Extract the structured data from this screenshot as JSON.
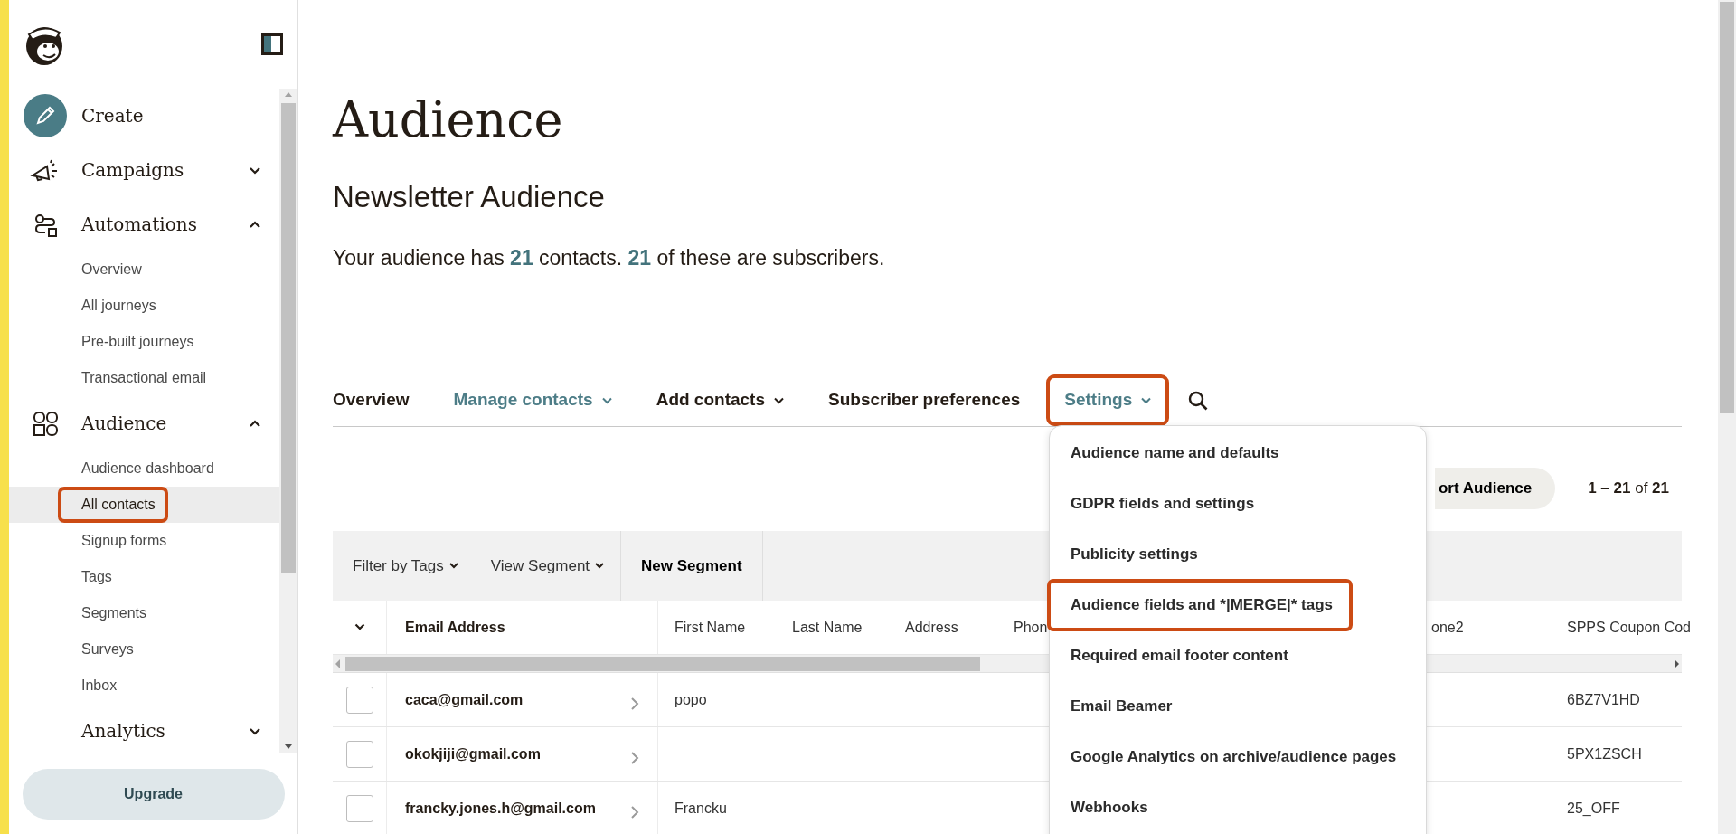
{
  "sidebar": {
    "nav": [
      {
        "kind": "action",
        "label": "Create"
      },
      {
        "kind": "section",
        "label": "Campaigns",
        "expanded": false
      },
      {
        "kind": "section",
        "label": "Automations",
        "expanded": true,
        "children": [
          {
            "label": "Overview",
            "selected": false,
            "highlighted": false
          },
          {
            "label": "All journeys",
            "selected": false,
            "highlighted": false
          },
          {
            "label": "Pre-built journeys",
            "selected": false,
            "highlighted": false
          },
          {
            "label": "Transactional email",
            "selected": false,
            "highlighted": false
          }
        ]
      },
      {
        "kind": "section",
        "label": "Audience",
        "expanded": true,
        "children": [
          {
            "label": "Audience dashboard",
            "selected": false,
            "highlighted": false
          },
          {
            "label": "All contacts",
            "selected": true,
            "highlighted": true
          },
          {
            "label": "Signup forms",
            "selected": false,
            "highlighted": false
          },
          {
            "label": "Tags",
            "selected": false,
            "highlighted": false
          },
          {
            "label": "Segments",
            "selected": false,
            "highlighted": false
          },
          {
            "label": "Surveys",
            "selected": false,
            "highlighted": false
          },
          {
            "label": "Inbox",
            "selected": false,
            "highlighted": false
          }
        ]
      },
      {
        "kind": "section",
        "label": "Analytics",
        "expanded": false
      }
    ],
    "upgrade_button": "Upgrade"
  },
  "page": {
    "title": "Audience",
    "subtitle": "Newsletter Audience",
    "summary": "Your audience has **21** contacts. **21** of these are subscribers."
  },
  "tabs": [
    {
      "label": "Overview",
      "selected": false,
      "has_menu": false,
      "highlighted": false
    },
    {
      "label": "Manage contacts",
      "selected": true,
      "has_menu": true,
      "highlighted": false
    },
    {
      "label": "Add contacts",
      "selected": false,
      "has_menu": true,
      "highlighted": false
    },
    {
      "label": "Subscriber preferences",
      "selected": false,
      "has_menu": false,
      "highlighted": false
    },
    {
      "label": "Settings",
      "selected": true,
      "has_menu": true,
      "highlighted": true
    }
  ],
  "settings_menu": [
    {
      "label": "Audience name and defaults",
      "highlighted": false
    },
    {
      "label": "GDPR fields and settings",
      "highlighted": false
    },
    {
      "label": "Publicity settings",
      "highlighted": false
    },
    {
      "label": "Audience fields and *|MERGE|* tags",
      "highlighted": true
    },
    {
      "label": "Required email footer content",
      "highlighted": false
    },
    {
      "label": "Email Beamer",
      "highlighted": false
    },
    {
      "label": "Google Analytics on archive/audience pages",
      "highlighted": false
    },
    {
      "label": "Webhooks",
      "highlighted": false
    }
  ],
  "export_button": "ort Audience",
  "pagination": "**1 – 21** of **21**",
  "toolbar": {
    "filters": [
      "Filter by Tags",
      "View Segment"
    ],
    "new_segment": "New Segment"
  },
  "table": {
    "columns": [
      "Email Address",
      "First Name",
      "Last Name",
      "Address",
      "Phon",
      "one2",
      "SPPS Coupon Cod"
    ],
    "rows": [
      {
        "checked": false,
        "email": "caca@gmail.com",
        "first_name": "popo",
        "coupon_code": "6BZ7V1HD"
      },
      {
        "checked": false,
        "email": "okokjiji@gmail.com",
        "coupon_code": "5PX1ZSCH"
      },
      {
        "checked": false,
        "email": "francky.jones.h@gmail.com",
        "first_name": "Francku",
        "coupon_code": "25_OFF"
      }
    ]
  }
}
